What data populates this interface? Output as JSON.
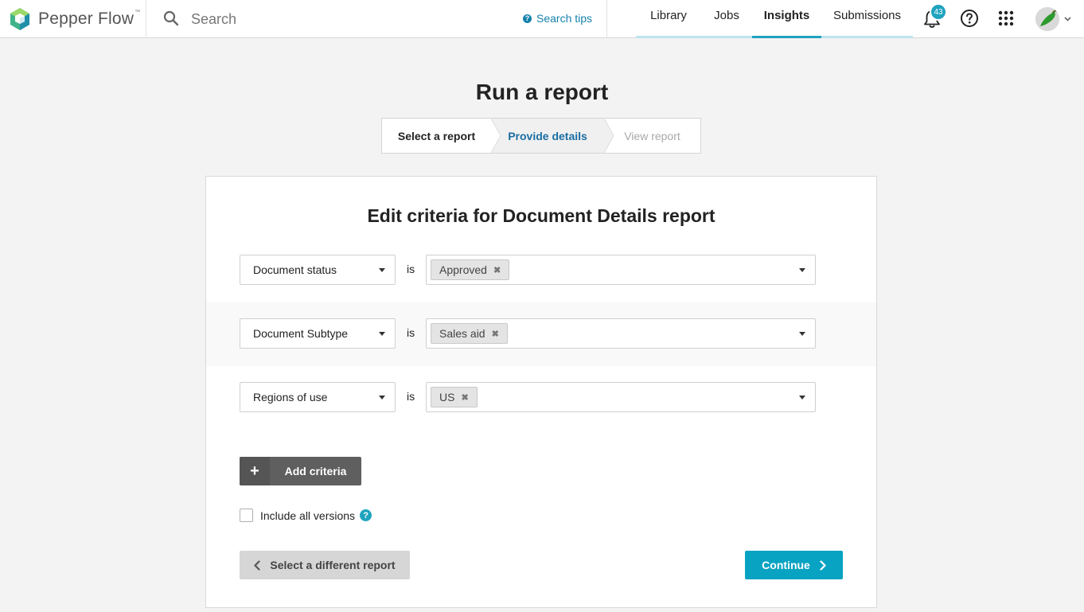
{
  "brand": {
    "name": "Pepper Flow",
    "trademark": "™"
  },
  "search": {
    "placeholder": "Search",
    "tips_label": "Search tips"
  },
  "nav": {
    "tabs": [
      "Library",
      "Jobs",
      "Insights",
      "Submissions"
    ],
    "active": "Insights"
  },
  "notifications": {
    "count": "43"
  },
  "page": {
    "title": "Run a report"
  },
  "steps": [
    {
      "label": "Select a report",
      "state": "done"
    },
    {
      "label": "Provide details",
      "state": "current"
    },
    {
      "label": "View report",
      "state": "upcoming"
    }
  ],
  "card": {
    "title": "Edit criteria for Document Details report"
  },
  "criteria": [
    {
      "field": "Document status",
      "operator": "is",
      "values": [
        "Approved"
      ]
    },
    {
      "field": "Document Subtype",
      "operator": "is",
      "values": [
        "Sales aid"
      ]
    },
    {
      "field": "Regions of use",
      "operator": "is",
      "values": [
        "US"
      ]
    }
  ],
  "buttons": {
    "add_criteria": "Add criteria",
    "back": "Select a different report",
    "continue": "Continue"
  },
  "include_versions": {
    "label": "Include all versions",
    "checked": false
  },
  "colors": {
    "accent": "#1fa3bf",
    "primary_button": "#08a2c2",
    "link": "#1582ad"
  }
}
